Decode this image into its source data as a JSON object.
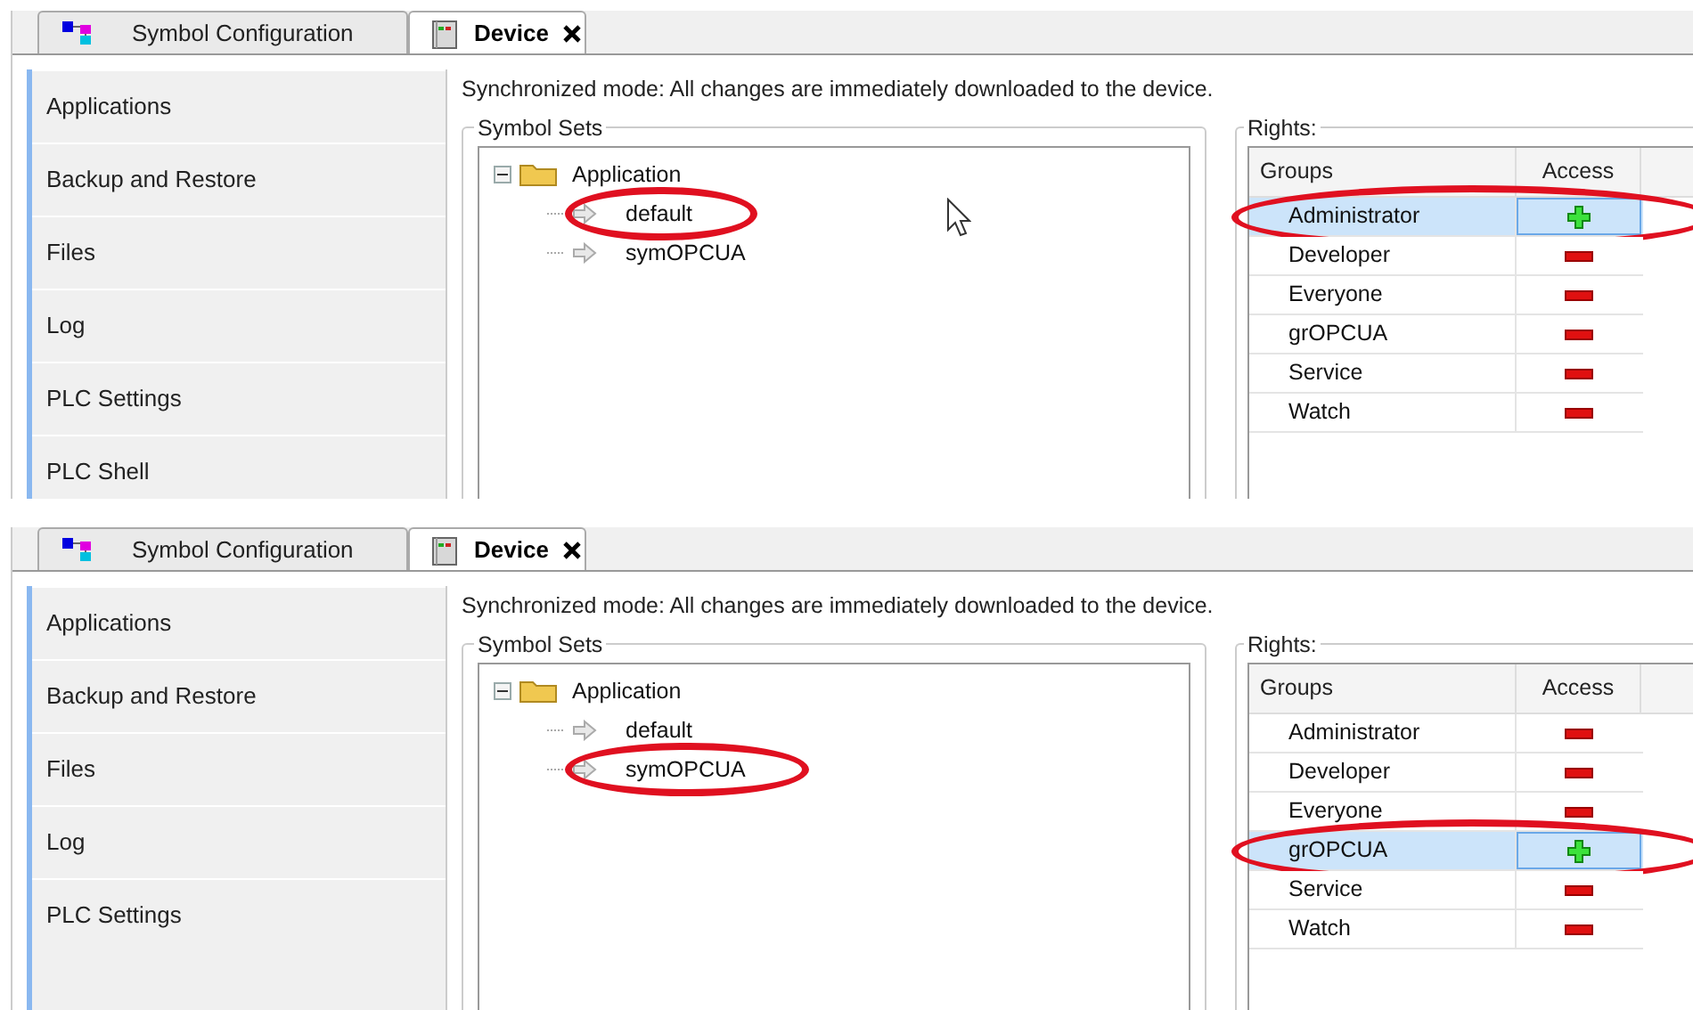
{
  "panels": [
    {
      "tabs": [
        {
          "label": "Symbol Configuration",
          "selected": false,
          "closable": false
        },
        {
          "label": "Device",
          "selected": true,
          "closable": true
        }
      ],
      "sidebar": {
        "items": [
          "Applications",
          "Backup and Restore",
          "Files",
          "Log",
          "PLC Settings",
          "PLC Shell"
        ]
      },
      "message": "Synchronized mode: All changes are immediately downloaded to the device.",
      "symbol_sets": {
        "title": "Symbol Sets",
        "tree": [
          {
            "label": "Application",
            "expanded": true,
            "children": [
              {
                "label": "default",
                "circled": true
              },
              {
                "label": "symOPCUA",
                "circled": false
              }
            ]
          }
        ]
      },
      "rights": {
        "title": "Rights:",
        "columns": [
          "Groups",
          "Access"
        ],
        "rows": [
          {
            "group": "Administrator",
            "access": true,
            "selected": true,
            "circled": true
          },
          {
            "group": "Developer",
            "access": false,
            "selected": false,
            "circled": false
          },
          {
            "group": "Everyone",
            "access": false,
            "selected": false,
            "circled": false
          },
          {
            "group": "grOPCUA",
            "access": false,
            "selected": false,
            "circled": false
          },
          {
            "group": "Service",
            "access": false,
            "selected": false,
            "circled": false
          },
          {
            "group": "Watch",
            "access": false,
            "selected": false,
            "circled": false
          }
        ]
      }
    },
    {
      "tabs": [
        {
          "label": "Symbol Configuration",
          "selected": false,
          "closable": false
        },
        {
          "label": "Device",
          "selected": true,
          "closable": true
        }
      ],
      "sidebar": {
        "items": [
          "Applications",
          "Backup and Restore",
          "Files",
          "Log",
          "PLC Settings"
        ]
      },
      "message": "Synchronized mode: All changes are immediately downloaded to the device.",
      "symbol_sets": {
        "title": "Symbol Sets",
        "tree": [
          {
            "label": "Application",
            "expanded": true,
            "children": [
              {
                "label": "default",
                "circled": false
              },
              {
                "label": "symOPCUA",
                "circled": true
              }
            ]
          }
        ]
      },
      "rights": {
        "title": "Rights:",
        "columns": [
          "Groups",
          "Access"
        ],
        "rows": [
          {
            "group": "Administrator",
            "access": false,
            "selected": false,
            "circled": false
          },
          {
            "group": "Developer",
            "access": false,
            "selected": false,
            "circled": false
          },
          {
            "group": "Everyone",
            "access": false,
            "selected": false,
            "circled": false
          },
          {
            "group": "grOPCUA",
            "access": true,
            "selected": true,
            "circled": true
          },
          {
            "group": "Service",
            "access": false,
            "selected": false,
            "circled": false
          },
          {
            "group": "Watch",
            "access": false,
            "selected": false,
            "circled": false
          }
        ]
      }
    }
  ]
}
